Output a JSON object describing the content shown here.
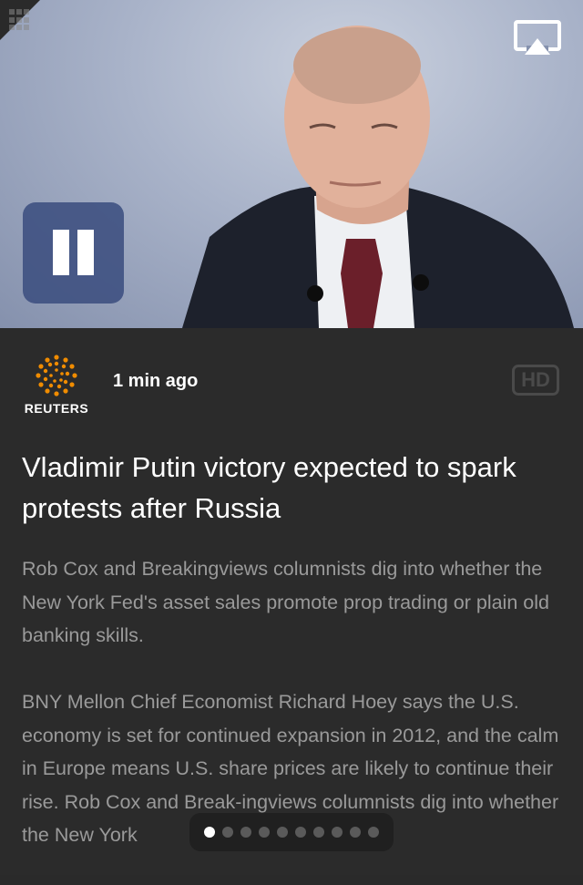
{
  "video": {
    "airplay_icon": "airplay-icon",
    "pause_icon": "pause-icon",
    "pause_button_color": "#3c4e80",
    "image_subject": "portrait-photo"
  },
  "article": {
    "source": "REUTERS",
    "time": "1 min ago",
    "hd_badge": "HD",
    "headline": "Vladimir Putin victory expected to spark protests after Russia",
    "paragraphs": [
      "Rob Cox and Breakingviews columnists dig into whether the New York Fed's asset sales promote prop trading or plain old banking skills.",
      "BNY Mellon Chief Economist Richard Hoey says the U.S. economy is set for continued expansion in 2012, and the calm in Europe means U.S. share prices are likely to continue their rise. Rob Cox and Break-ingviews columnists dig into whether the New York"
    ]
  },
  "page_indicator": {
    "count": 10,
    "active_index": 0
  },
  "colors": {
    "background": "#2b2b2b",
    "headline": "#ffffff",
    "body": "#9a9a9a",
    "reuters_orange": "#f08c00"
  }
}
